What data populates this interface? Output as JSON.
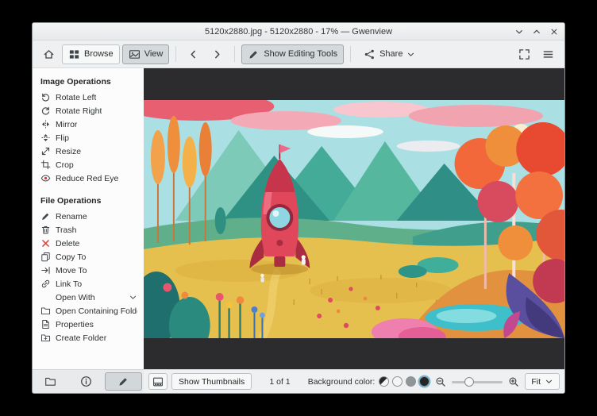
{
  "window": {
    "title": "5120x2880.jpg - 5120x2880 - 17% — Gwenview"
  },
  "toolbar": {
    "browse": "Browse",
    "view": "View",
    "show_editing_tools": "Show Editing Tools",
    "share": "Share"
  },
  "sidebar": {
    "sections": [
      {
        "title": "Image Operations",
        "items": [
          {
            "label": "Rotate Left",
            "icon": "rotate-left-icon"
          },
          {
            "label": "Rotate Right",
            "icon": "rotate-right-icon"
          },
          {
            "label": "Mirror",
            "icon": "mirror-icon"
          },
          {
            "label": "Flip",
            "icon": "flip-icon"
          },
          {
            "label": "Resize",
            "icon": "resize-icon"
          },
          {
            "label": "Crop",
            "icon": "crop-icon"
          },
          {
            "label": "Reduce Red Eye",
            "icon": "red-eye-icon"
          }
        ]
      },
      {
        "title": "File Operations",
        "items": [
          {
            "label": "Rename",
            "icon": "rename-pencil-icon"
          },
          {
            "label": "Trash",
            "icon": "trash-icon"
          },
          {
            "label": "Delete",
            "icon": "delete-cross-icon"
          },
          {
            "label": "Copy To",
            "icon": "copy-icon"
          },
          {
            "label": "Move To",
            "icon": "move-arrow-icon"
          },
          {
            "label": "Link To",
            "icon": "link-chain-icon"
          },
          {
            "label": "Open With",
            "icon": "chevron-down-icon"
          },
          {
            "label": "Open Containing Folder",
            "icon": "folder-icon"
          },
          {
            "label": "Properties",
            "icon": "document-properties-icon"
          },
          {
            "label": "Create Folder",
            "icon": "folder-new-icon"
          }
        ]
      }
    ],
    "tabs": [
      "folders",
      "information",
      "operations"
    ],
    "active_tab": "operations"
  },
  "statusbar": {
    "show_thumbnails": "Show Thumbnails",
    "counter": "1 of 1",
    "background_label": "Background color:",
    "background_options": [
      "auto",
      "light",
      "gray",
      "dark"
    ],
    "selected_background": "dark",
    "zoom_mode": "Fit"
  },
  "colors": {
    "titlebar_bg": "#eff0f1",
    "viewer_bg": "#2c2c2e",
    "accent": "#3daee9"
  }
}
